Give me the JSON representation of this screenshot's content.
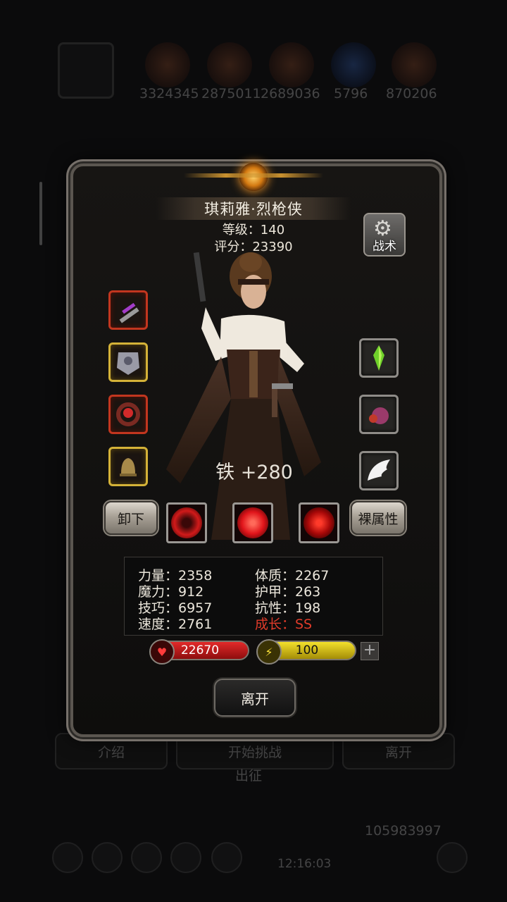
{
  "background": {
    "resources": [
      "3324345",
      "2875011",
      "2689036",
      "5796",
      "870206"
    ],
    "bottom_buttons": [
      "介绍",
      "开始挑战",
      "离开"
    ],
    "sub_label": "出征",
    "gold": "105983997",
    "clock": "12:16:03"
  },
  "hero": {
    "name": "琪莉雅·烈枪侠",
    "level_text": "等级：140",
    "score_text": "评分：23390",
    "tactic_label": "战术",
    "equip_bonus": "铁 +280",
    "left_slots": [
      "pistol-icon",
      "armor-icon",
      "ring-icon",
      "bell-icon"
    ],
    "right_slots": [
      "green-crystal-icon",
      "purple-orb-icon",
      "white-wing-icon"
    ]
  },
  "actions": {
    "unequip": "卸下",
    "bare_attr": "裸属性",
    "leave": "离开"
  },
  "skills": [
    "crosshair-skill-icon",
    "vortex-skill-icon",
    "target-skill-icon"
  ],
  "stats": {
    "strength": "力量：2358",
    "constitution": "体质：2267",
    "magic": "魔力：912",
    "armor": "护甲：263",
    "skill": "技巧：6957",
    "resistance": "抗性：198",
    "speed": "速度：2761",
    "growth": "成长：SS"
  },
  "bars": {
    "hp": "22670",
    "energy": "100"
  },
  "colors": {
    "growth": "#e03b2a",
    "hp": "#c81818",
    "energy": "#e6cf1a"
  }
}
